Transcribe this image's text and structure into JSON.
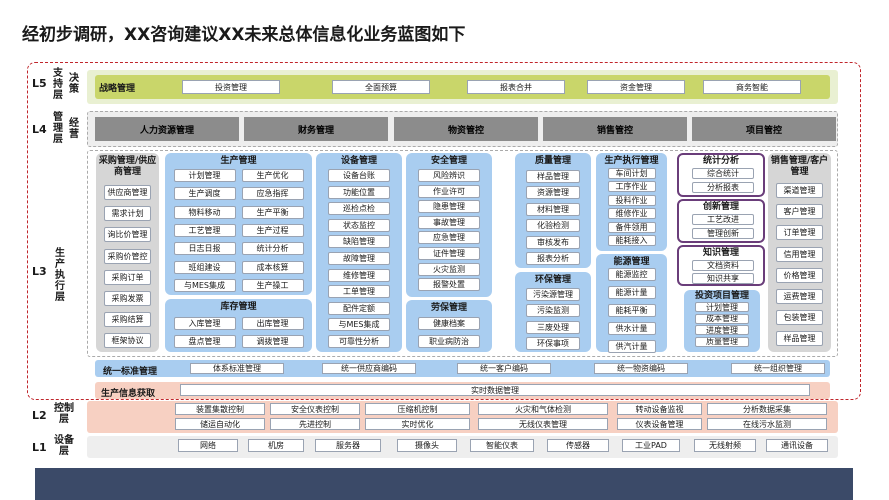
{
  "title": "经初步调研，XX咨询建议XX未来总体信息化业务蓝图如下",
  "levels": {
    "l5": {
      "num": "L5",
      "name_a": "支持层",
      "name_b": "决策"
    },
    "l4": {
      "num": "L4",
      "name_a": "管理层",
      "name_b": "经营"
    },
    "l3": {
      "num": "L3",
      "name": "生产执行层"
    },
    "l2": {
      "num": "L2",
      "name": "控制层"
    },
    "l1": {
      "num": "L1",
      "name": "设备层"
    }
  },
  "strategy": {
    "label": "战略管理",
    "items": [
      "投资管理",
      "全面预算",
      "报表合并",
      "资金管理",
      "商务智能"
    ]
  },
  "operations": {
    "items": [
      "人力资源管理",
      "财务管理",
      "物资管控",
      "销售管控",
      "项目管控"
    ]
  },
  "procurement": {
    "title": "采购管理/供应商管理",
    "items": [
      "供应商管理",
      "需求计划",
      "询比价管理",
      "采购价管控",
      "采购订单",
      "采购发票",
      "采购结算",
      "框架协议"
    ]
  },
  "production": {
    "title": "生产管理",
    "items": [
      "计划管理",
      "生产优化",
      "生产调度",
      "应急指挥",
      "物料移动",
      "生产平衡",
      "工艺管理",
      "生产过程",
      "日志日报",
      "统计分析",
      "班组建设",
      "成本核算",
      "与MES集成",
      "生产操工"
    ]
  },
  "inventory": {
    "title": "库存管理",
    "items": [
      "入库管理",
      "出库管理",
      "盘点管理",
      "调拨管理"
    ]
  },
  "equipment": {
    "title": "设备管理",
    "items": [
      "设备台账",
      "功能位置",
      "巡检点检",
      "状态监控",
      "缺陷管理",
      "故障管理",
      "维修管理",
      "工单管理",
      "配件定额",
      "与MES集成",
      "可靠性分析"
    ]
  },
  "safety": {
    "title": "安全管理",
    "items": [
      "风险辨识",
      "作业许可",
      "隐患管理",
      "事故管理",
      "应急管理",
      "证件管理",
      "火灾监测",
      "报警处置"
    ]
  },
  "labor": {
    "title": "劳保管理",
    "items": [
      "健康档案",
      "职业病防治"
    ]
  },
  "quality": {
    "title": "质量管理",
    "items": [
      "样品管理",
      "资源管理",
      "材料管理",
      "化验检测",
      "审核发布",
      "报表分析"
    ]
  },
  "environment": {
    "title": "环保管理",
    "items": [
      "污染源管理",
      "污染监测",
      "三废处理",
      "环保事项"
    ]
  },
  "mes": {
    "title": "生产执行管理",
    "items": [
      "车间计划",
      "工序作业",
      "投料作业",
      "维修作业",
      "备件领用",
      "能耗接入"
    ]
  },
  "energy": {
    "title": "能源管理",
    "items": [
      "能源监控",
      "能源计量",
      "能耗平衡",
      "供水计量",
      "供汽计量"
    ]
  },
  "stats": {
    "title": "统计分析",
    "items": [
      "综合统计",
      "分析报表"
    ]
  },
  "innovation": {
    "title": "创新管理",
    "items": [
      "工艺改进",
      "管理创新"
    ]
  },
  "knowledge": {
    "title": "知识管理",
    "items": [
      "文档资料",
      "知识共享"
    ]
  },
  "investment_project": {
    "title": "投资项目管理",
    "items": [
      "计划管理",
      "成本管理",
      "进度管理",
      "质量管理"
    ]
  },
  "sales": {
    "title": "销售管理/客户管理",
    "items": [
      "渠道管理",
      "客户管理",
      "订单管理",
      "信用管理",
      "价格管理",
      "运费管理",
      "包装管理",
      "样品管理"
    ]
  },
  "unified": {
    "label": "统一标准管理",
    "items": [
      "体系标准管理",
      "统一供应商编码",
      "统一客户编码",
      "统一物资编码",
      "统一组织管理"
    ]
  },
  "data_acq": {
    "label": "生产信息获取",
    "item": "实时数据管理"
  },
  "control": {
    "row1": [
      "装置集散控制",
      "安全仪表控制",
      "压缩机控制",
      "火灾和气体检测",
      "转动设备监视",
      "分析数据采集"
    ],
    "row2": [
      "储运自动化",
      "先进控制",
      "实时优化",
      "无线仪表管理",
      "仪表设备管理",
      "在线污水监测"
    ]
  },
  "devices": {
    "items": [
      "网络",
      "机房",
      "服务器",
      "摄像头",
      "智能仪表",
      "传感器",
      "工业PAD",
      "无线射频",
      "通讯设备"
    ]
  },
  "colors": {
    "l5_band": "#e9f0d2",
    "l5_inner": "#c9d66a",
    "l4_band": "#eeeeee",
    "gray_bar": "#8c8c8c",
    "l3_gray": "#d6d6d6",
    "l3_blue": "#a9cdf0",
    "unified": "#a9cdf0",
    "acq": "#f7d0c2",
    "l2_band": "#f7d0c2",
    "l1_band": "#eeeeee",
    "purple": "#6a3d7a",
    "red_dash": "#c0262c",
    "footer": "#3b4a68"
  }
}
